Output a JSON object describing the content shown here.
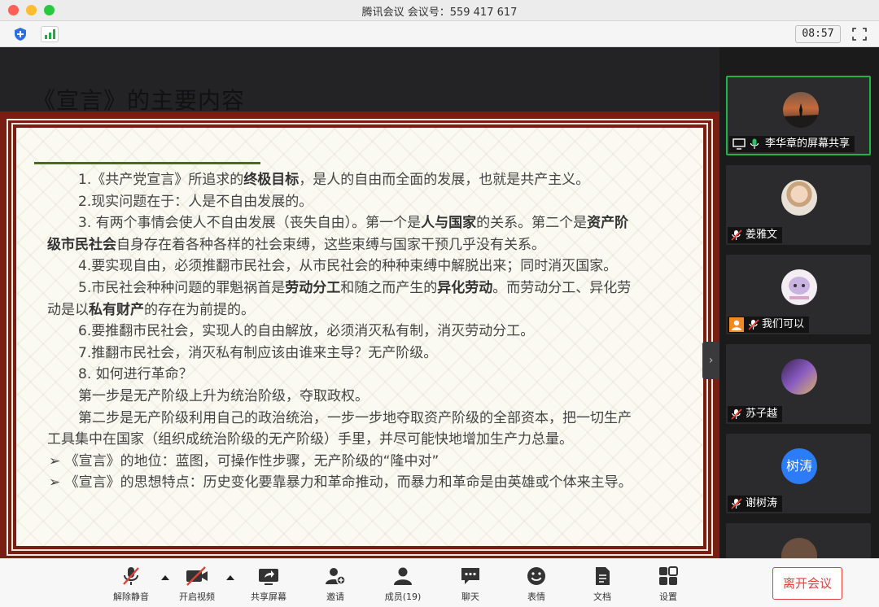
{
  "window": {
    "title": "腾讯会议 会议号：559 417 617"
  },
  "topbar": {
    "time": "08:57",
    "icons": [
      "shield-icon",
      "signal-icon",
      "fullscreen-icon"
    ]
  },
  "slide": {
    "title": "《宣言》的主要内容",
    "lines": [
      {
        "type": "indent",
        "parts": [
          {
            "t": "1.《共产党宣言》所追求的"
          },
          {
            "t": "终极目标",
            "b": true
          },
          {
            "t": "，是人的自由而全面的发展，也就是共产主义。"
          }
        ]
      },
      {
        "type": "indent",
        "parts": [
          {
            "t": "2.现实问题在于：人是不自由发展的。"
          }
        ]
      },
      {
        "type": "indent",
        "parts": [
          {
            "t": "3. 有两个事情会使人不自由发展（丧失自由）。第一个是"
          },
          {
            "t": "人与国家",
            "b": true
          },
          {
            "t": "的关系。第二个是"
          },
          {
            "t": "资产阶",
            "b": true
          }
        ]
      },
      {
        "type": "plain",
        "parts": [
          {
            "t": "级市民社会",
            "b": true
          },
          {
            "t": "自身存在着各种各样的社会束缚，这些束缚与国家干预几乎没有关系。"
          }
        ]
      },
      {
        "type": "indent",
        "parts": [
          {
            "t": "4.要实现自由，必须推翻市民社会，从市民社会的种种束缚中解脱出来；同时消灭国家。"
          }
        ]
      },
      {
        "type": "indent",
        "parts": [
          {
            "t": "5.市民社会种种问题的罪魁祸首是"
          },
          {
            "t": "劳动分工",
            "b": true
          },
          {
            "t": "和随之而产生的"
          },
          {
            "t": "异化劳动",
            "b": true
          },
          {
            "t": "。而劳动分工、异化劳"
          }
        ]
      },
      {
        "type": "plain",
        "parts": [
          {
            "t": "动是以"
          },
          {
            "t": "私有财产",
            "b": true
          },
          {
            "t": "的存在为前提的。"
          }
        ]
      },
      {
        "type": "indent",
        "parts": [
          {
            "t": "6.要推翻市民社会，实现人的自由解放，必须消灭私有制，消灭劳动分工。"
          }
        ]
      },
      {
        "type": "indent",
        "parts": [
          {
            "t": "7.推翻市民社会，消灭私有制应该由谁来主导？无产阶级。"
          }
        ]
      },
      {
        "type": "indent",
        "parts": [
          {
            "t": "8. 如何进行革命？"
          }
        ]
      },
      {
        "type": "indent",
        "parts": [
          {
            "t": "第一步是无产阶级上升为统治阶级，夺取政权。"
          }
        ]
      },
      {
        "type": "indent",
        "parts": [
          {
            "t": "第二步是无产阶级利用自己的政治统治，一步一步地夺取资产阶级的全部资本，把一切生产"
          }
        ]
      },
      {
        "type": "plain",
        "parts": [
          {
            "t": "工具集中在国家（组织成统治阶级的无产阶级）手里，并尽可能快地增加生产力总量。"
          }
        ]
      },
      {
        "type": "bullet",
        "parts": [
          {
            "t": "➢ 《宣言》的地位：蓝图，可操作性步骤，无产阶级的“隆中对”"
          }
        ]
      },
      {
        "type": "bullet",
        "parts": [
          {
            "t": "➢ 《宣言》的思想特点：历史变化要靠暴力和革命推动，而暴力和革命是由英雄或个体来主导。"
          }
        ]
      }
    ]
  },
  "gallery": {
    "participants": [
      {
        "name": "李华章的屏幕共享",
        "active": true,
        "avatar": "sunset-photo",
        "status": "screen-share"
      },
      {
        "name": "姜雅文",
        "active": false,
        "avatar": "portrait-photo",
        "status": "muted"
      },
      {
        "name": "我们可以",
        "active": false,
        "avatar": "cartoon-photo",
        "status": "muted"
      },
      {
        "name": "苏子越",
        "active": false,
        "avatar": "purple-photo",
        "status": "muted"
      },
      {
        "name": "谢树涛",
        "active": false,
        "avatar_text": "树涛",
        "avatar_color": "#2b7cf6",
        "status": "muted"
      }
    ]
  },
  "bottombar": {
    "controls": [
      {
        "label": "解除静音",
        "icon": "mic-muted-icon"
      },
      {
        "label": "开启视频",
        "icon": "video-off-icon"
      },
      {
        "label": "共享屏幕",
        "icon": "share-screen-icon"
      },
      {
        "label": "邀请",
        "icon": "invite-icon"
      },
      {
        "label": "成员(19)",
        "icon": "members-icon"
      },
      {
        "label": "聊天",
        "icon": "chat-icon"
      },
      {
        "label": "表情",
        "icon": "emoji-icon"
      },
      {
        "label": "文档",
        "icon": "document-icon"
      },
      {
        "label": "设置",
        "icon": "settings-icon"
      }
    ],
    "leave": "离开会议"
  },
  "colors": {
    "slide_border": "#7a1d12",
    "active_tile": "#22b24c",
    "leave": "#e0413a",
    "avatar_blue": "#2b7cf6"
  }
}
